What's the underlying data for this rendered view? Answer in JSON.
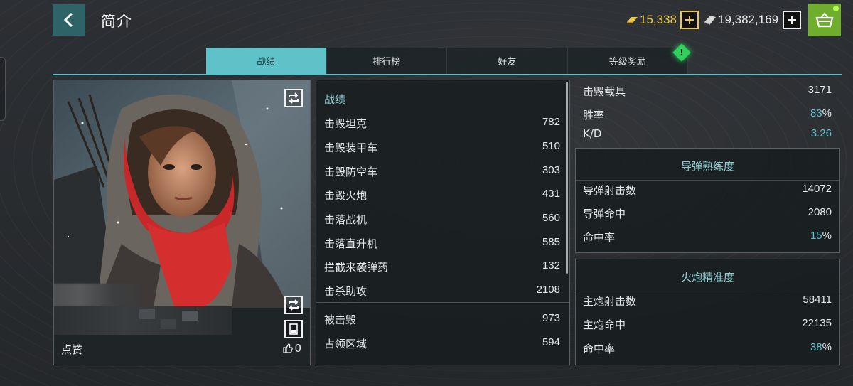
{
  "header": {
    "title": "简介",
    "gold": "15,338",
    "silver": "19,382,169"
  },
  "tabs": [
    {
      "label": "战绩",
      "active": true
    },
    {
      "label": "排行榜",
      "active": false
    },
    {
      "label": "好友",
      "active": false
    },
    {
      "label": "等级奖励",
      "active": false,
      "badge": "!"
    }
  ],
  "profile": {
    "likes_label": "点赞",
    "likes_count": "0"
  },
  "combat": {
    "header": "战绩",
    "rows": [
      {
        "label": "击毁坦克",
        "value": "782"
      },
      {
        "label": "击毁装甲车",
        "value": "510"
      },
      {
        "label": "击毁防空车",
        "value": "303"
      },
      {
        "label": "击毁火炮",
        "value": "431"
      },
      {
        "label": "击落战机",
        "value": "560"
      },
      {
        "label": "击落直升机",
        "value": "585"
      },
      {
        "label": "拦截来袭弹药",
        "value": "132"
      },
      {
        "label": "击杀助攻",
        "value": "2108"
      },
      {
        "label": "被击毁",
        "value": "973"
      },
      {
        "label": "占领区域",
        "value": "594"
      }
    ]
  },
  "summary": {
    "vehicles_label": "击毁载具",
    "vehicles_value": "3171",
    "winrate_label": "胜率",
    "winrate_value": "83",
    "winrate_unit": "%",
    "kd_label": "K/D",
    "kd_value": "3.26"
  },
  "missile": {
    "title": "导弹熟练度",
    "shots_label": "导弹射击数",
    "shots_value": "14072",
    "hits_label": "导弹命中",
    "hits_value": "2080",
    "rate_label": "命中率",
    "rate_value": "15",
    "rate_unit": "%"
  },
  "cannon": {
    "title": "火炮精准度",
    "shots_label": "主炮射击数",
    "shots_value": "58411",
    "hits_label": "主炮命中",
    "hits_value": "22135",
    "rate_label": "命中率",
    "rate_value": "38",
    "rate_unit": "%"
  },
  "colors": {
    "accent": "#5fc2c8",
    "gold": "#e9c84a",
    "shop": "#6fae2c",
    "badge": "#2fd15c"
  },
  "icons": [
    "chevron-left-icon",
    "gold-bar-icon",
    "silver-bar-icon",
    "plus-icon",
    "basket-icon",
    "swap-icon",
    "card-icon",
    "thumbs-up-icon"
  ]
}
